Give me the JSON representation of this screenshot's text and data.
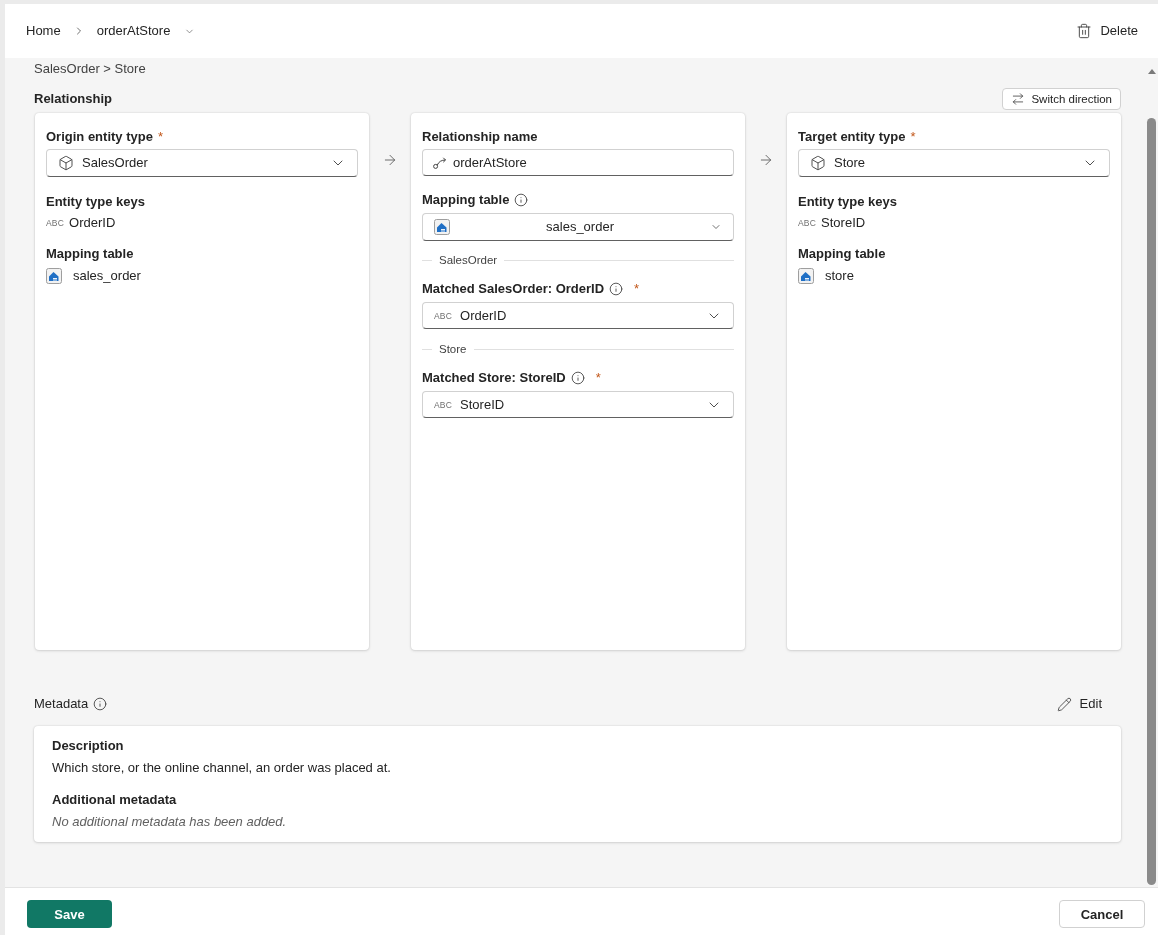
{
  "header": {
    "breadcrumb": [
      {
        "label": "Home",
        "kind": "link"
      },
      {
        "label": "orderAtStore",
        "kind": "menu"
      }
    ],
    "delete_button": "Delete"
  },
  "path": "SalesOrder > Store",
  "relationship": {
    "title": "Relationship",
    "switch_button": "Switch direction",
    "cards": [
      {
        "kind": "entity",
        "label": "Origin entity type",
        "required_mark": "*",
        "value": "SalesOrder",
        "keys_label": "Entity type keys",
        "keys": [
          {
            "type_tag": "ABC",
            "name": "OrderID"
          }
        ],
        "mapping_label": "Mapping table",
        "mapping_table": "sales_order"
      },
      {
        "kind": "relationship",
        "name_label": "Relationship name",
        "name_value": "orderAtStore",
        "mapping_label": "Mapping table",
        "mapping_value": "sales_order",
        "matches": [
          {
            "section": "SalesOrder",
            "label": "Matched SalesOrder: OrderID",
            "required_mark": "*",
            "type_tag": "ABC",
            "value": "OrderID"
          },
          {
            "section": "Store",
            "label": "Matched Store: StoreID",
            "required_mark": "*",
            "type_tag": "ABC",
            "value": "StoreID"
          }
        ]
      },
      {
        "kind": "entity",
        "label": "Target entity type",
        "required_mark": "*",
        "value": "Store",
        "keys_label": "Entity type keys",
        "keys": [
          {
            "type_tag": "ABC",
            "name": "StoreID"
          }
        ],
        "mapping_label": "Mapping table",
        "mapping_table": "store"
      }
    ]
  },
  "metadata": {
    "title": "Metadata",
    "edit_button": "Edit",
    "fields": [
      {
        "kind": "text",
        "label": "Description",
        "value": "Which store, or the online channel, an order was placed at."
      },
      {
        "kind": "empty",
        "label": "Additional metadata",
        "value": "No additional metadata has been added."
      }
    ]
  },
  "footer": {
    "save_button": "Save",
    "cancel_button": "Cancel"
  }
}
